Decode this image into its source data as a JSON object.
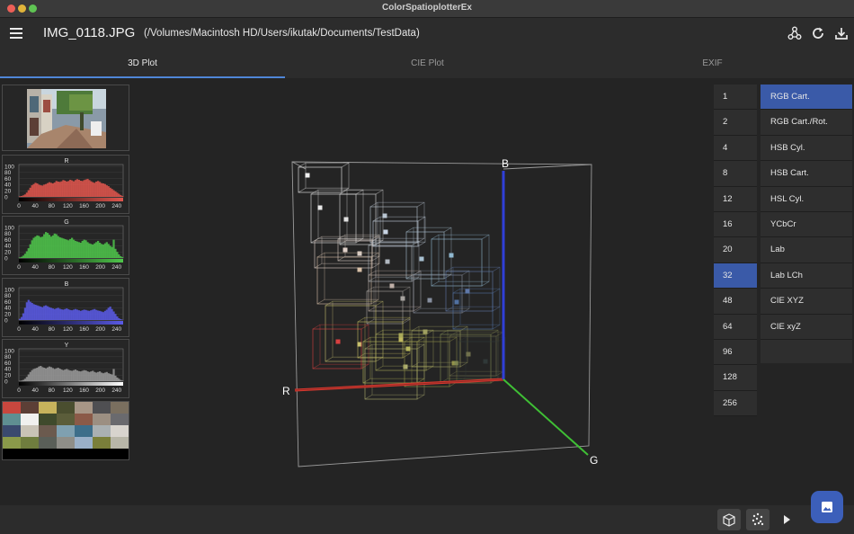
{
  "window": {
    "title": "ColorSpatioplotterEx"
  },
  "header": {
    "file_name": "IMG_0118.JPG",
    "file_path": "(/Volumes/Macintosh HD/Users/ikutak/Documents/TestData)",
    "icons": [
      "menu-icon",
      "share-icon",
      "refresh-icon",
      "download-icon"
    ]
  },
  "tabs": [
    {
      "label": "3D Plot",
      "active": true
    },
    {
      "label": "CIE Plot",
      "active": false
    },
    {
      "label": "EXIF",
      "active": false
    }
  ],
  "histograms": [
    {
      "label": "R",
      "color": "#e0564e",
      "y_ticks": [
        "100",
        "80",
        "60",
        "40",
        "20",
        "0"
      ],
      "x_ticks": [
        "0",
        "40",
        "80",
        "120",
        "160",
        "200",
        "240"
      ],
      "values": [
        2,
        3,
        5,
        8,
        14,
        22,
        30,
        38,
        42,
        46,
        44,
        40,
        38,
        37,
        40,
        42,
        45,
        48,
        46,
        44,
        47,
        52,
        50,
        49,
        51,
        55,
        53,
        50,
        52,
        56,
        54,
        51,
        55,
        58,
        56,
        53,
        52,
        55,
        57,
        59,
        55,
        51,
        48,
        46,
        50,
        52,
        49,
        45,
        44,
        42,
        38,
        35,
        30,
        26,
        22,
        18,
        14,
        10,
        6,
        3
      ]
    },
    {
      "label": "G",
      "color": "#4fc64b",
      "y_ticks": [
        "100",
        "80",
        "60",
        "40",
        "20",
        "0"
      ],
      "x_ticks": [
        "0",
        "40",
        "80",
        "120",
        "160",
        "200",
        "240"
      ],
      "values": [
        2,
        4,
        8,
        14,
        22,
        32,
        45,
        58,
        66,
        70,
        74,
        72,
        68,
        70,
        78,
        85,
        82,
        76,
        70,
        74,
        80,
        78,
        72,
        68,
        66,
        64,
        62,
        60,
        58,
        62,
        66,
        60,
        56,
        54,
        52,
        50,
        56,
        60,
        58,
        52,
        48,
        46,
        44,
        48,
        52,
        56,
        50,
        46,
        44,
        48,
        52,
        46,
        40,
        36,
        60,
        30,
        20,
        12,
        6,
        3
      ]
    },
    {
      "label": "B",
      "color": "#5a5ae6",
      "y_ticks": [
        "100",
        "80",
        "60",
        "40",
        "20",
        "0"
      ],
      "x_ticks": [
        "0",
        "40",
        "80",
        "120",
        "160",
        "200",
        "240"
      ],
      "values": [
        4,
        10,
        22,
        40,
        58,
        66,
        60,
        56,
        52,
        50,
        48,
        46,
        44,
        42,
        46,
        48,
        45,
        42,
        40,
        38,
        36,
        38,
        40,
        37,
        35,
        34,
        36,
        38,
        35,
        33,
        32,
        34,
        36,
        34,
        32,
        30,
        32,
        34,
        33,
        31,
        30,
        32,
        34,
        36,
        33,
        31,
        30,
        28,
        26,
        30,
        34,
        40,
        44,
        36,
        28,
        20,
        12,
        6,
        3,
        1
      ]
    },
    {
      "label": "Y",
      "color": "#9a9a9a",
      "y_ticks": [
        "100",
        "80",
        "60",
        "40",
        "20",
        "0"
      ],
      "x_ticks": [
        "0",
        "40",
        "80",
        "120",
        "160",
        "200",
        "240"
      ],
      "values": [
        1,
        2,
        4,
        8,
        14,
        22,
        30,
        36,
        40,
        42,
        44,
        48,
        50,
        46,
        44,
        42,
        45,
        48,
        46,
        43,
        40,
        42,
        44,
        41,
        38,
        36,
        38,
        40,
        37,
        35,
        34,
        36,
        38,
        35,
        33,
        32,
        34,
        36,
        35,
        32,
        30,
        32,
        34,
        30,
        28,
        30,
        32,
        28,
        26,
        28,
        30,
        26,
        24,
        22,
        40,
        18,
        12,
        8,
        4,
        2
      ]
    }
  ],
  "palette": [
    "#c8473e",
    "#5c3f36",
    "#c7b35c",
    "#4a4e2f",
    "#a79686",
    "#4f4f52",
    "#7a6f5f",
    "#5f8f92",
    "#f1f1ef",
    "#3f4a2c",
    "#5b5d3a",
    "#8b5a48",
    "#9c8f82",
    "#6a6a6e",
    "#3a4a6e",
    "#c9c3b6",
    "#6b5a4e",
    "#7fa0b0",
    "#3d6e8a",
    "#aab0b2",
    "#d8d4ce",
    "#8a9a4a",
    "#6f7d3e",
    "#5a5f58",
    "#8f8e88",
    "#9ab0c8",
    "#7a7f3a",
    "#b8b6a8"
  ],
  "plot3d": {
    "axis_labels": {
      "r": "R",
      "g": "G",
      "b": "B"
    },
    "axis_colors": {
      "r": "#d8382f",
      "g": "#3fbf35",
      "b": "#2f3fd8"
    }
  },
  "bins": {
    "items": [
      "1",
      "2",
      "4",
      "8",
      "12",
      "16",
      "20",
      "32",
      "48",
      "64",
      "96",
      "128",
      "256"
    ],
    "selected": "32"
  },
  "modes": {
    "items": [
      "RGB Cart.",
      "RGB Cart./Rot.",
      "HSB Cyl.",
      "HSB Cart.",
      "HSL Cyl.",
      "YCbCr",
      "Lab",
      "Lab LCh",
      "CIE XYZ",
      "CIE xyZ"
    ],
    "selected": "RGB Cart."
  },
  "bottom_bar": {
    "icons": [
      "cube-icon",
      "scatter-icon",
      "play-icon"
    ]
  },
  "fab": {
    "icon": "image-icon"
  }
}
